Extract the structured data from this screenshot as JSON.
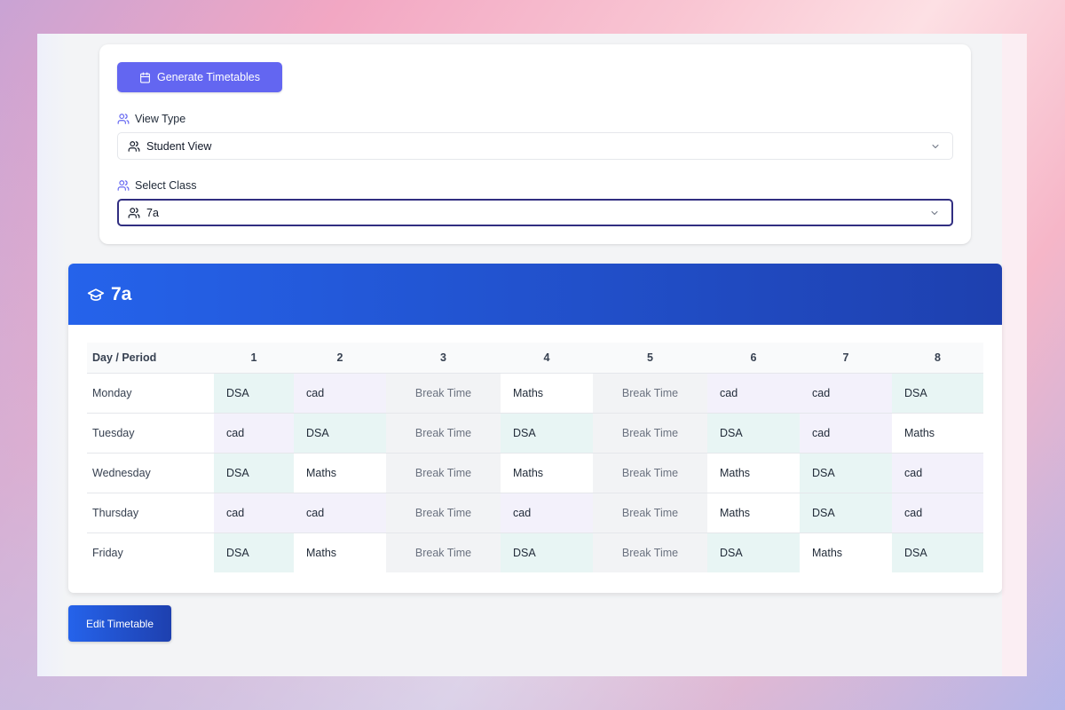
{
  "controls": {
    "generate_label": "Generate Timetables",
    "view_type_label": "View Type",
    "view_type_value": "Student View",
    "select_class_label": "Select Class",
    "select_class_value": "7a"
  },
  "timetable": {
    "title": "7a",
    "header": {
      "day_period": "Day / Period",
      "periods": [
        "1",
        "2",
        "3",
        "4",
        "5",
        "6",
        "7",
        "8"
      ]
    },
    "rows": [
      {
        "day": "Monday",
        "cells": [
          "DSA",
          "cad",
          "Break Time",
          "Maths",
          "Break Time",
          "cad",
          "cad",
          "DSA"
        ]
      },
      {
        "day": "Tuesday",
        "cells": [
          "cad",
          "DSA",
          "Break Time",
          "DSA",
          "Break Time",
          "DSA",
          "cad",
          "Maths"
        ]
      },
      {
        "day": "Wednesday",
        "cells": [
          "DSA",
          "Maths",
          "Break Time",
          "Maths",
          "Break Time",
          "Maths",
          "DSA",
          "cad"
        ]
      },
      {
        "day": "Thursday",
        "cells": [
          "cad",
          "cad",
          "Break Time",
          "cad",
          "Break Time",
          "Maths",
          "DSA",
          "cad"
        ]
      },
      {
        "day": "Friday",
        "cells": [
          "DSA",
          "Maths",
          "Break Time",
          "DSA",
          "Break Time",
          "DSA",
          "Maths",
          "DSA"
        ]
      }
    ]
  },
  "edit_label": "Edit Timetable",
  "colors": {
    "primary_button": "#6366f1",
    "header_gradient_start": "#2563eb",
    "header_gradient_end": "#1e40af",
    "dsa_cell": "#e8f5f4",
    "cad_cell": "#f3f1fb",
    "break_cell": "#f2f3f5"
  },
  "icons": {
    "generate": "calendar-icon",
    "view_type": "users-icon",
    "select_class": "users-icon",
    "chevron": "chevron-down-icon",
    "title": "graduation-cap-icon"
  }
}
